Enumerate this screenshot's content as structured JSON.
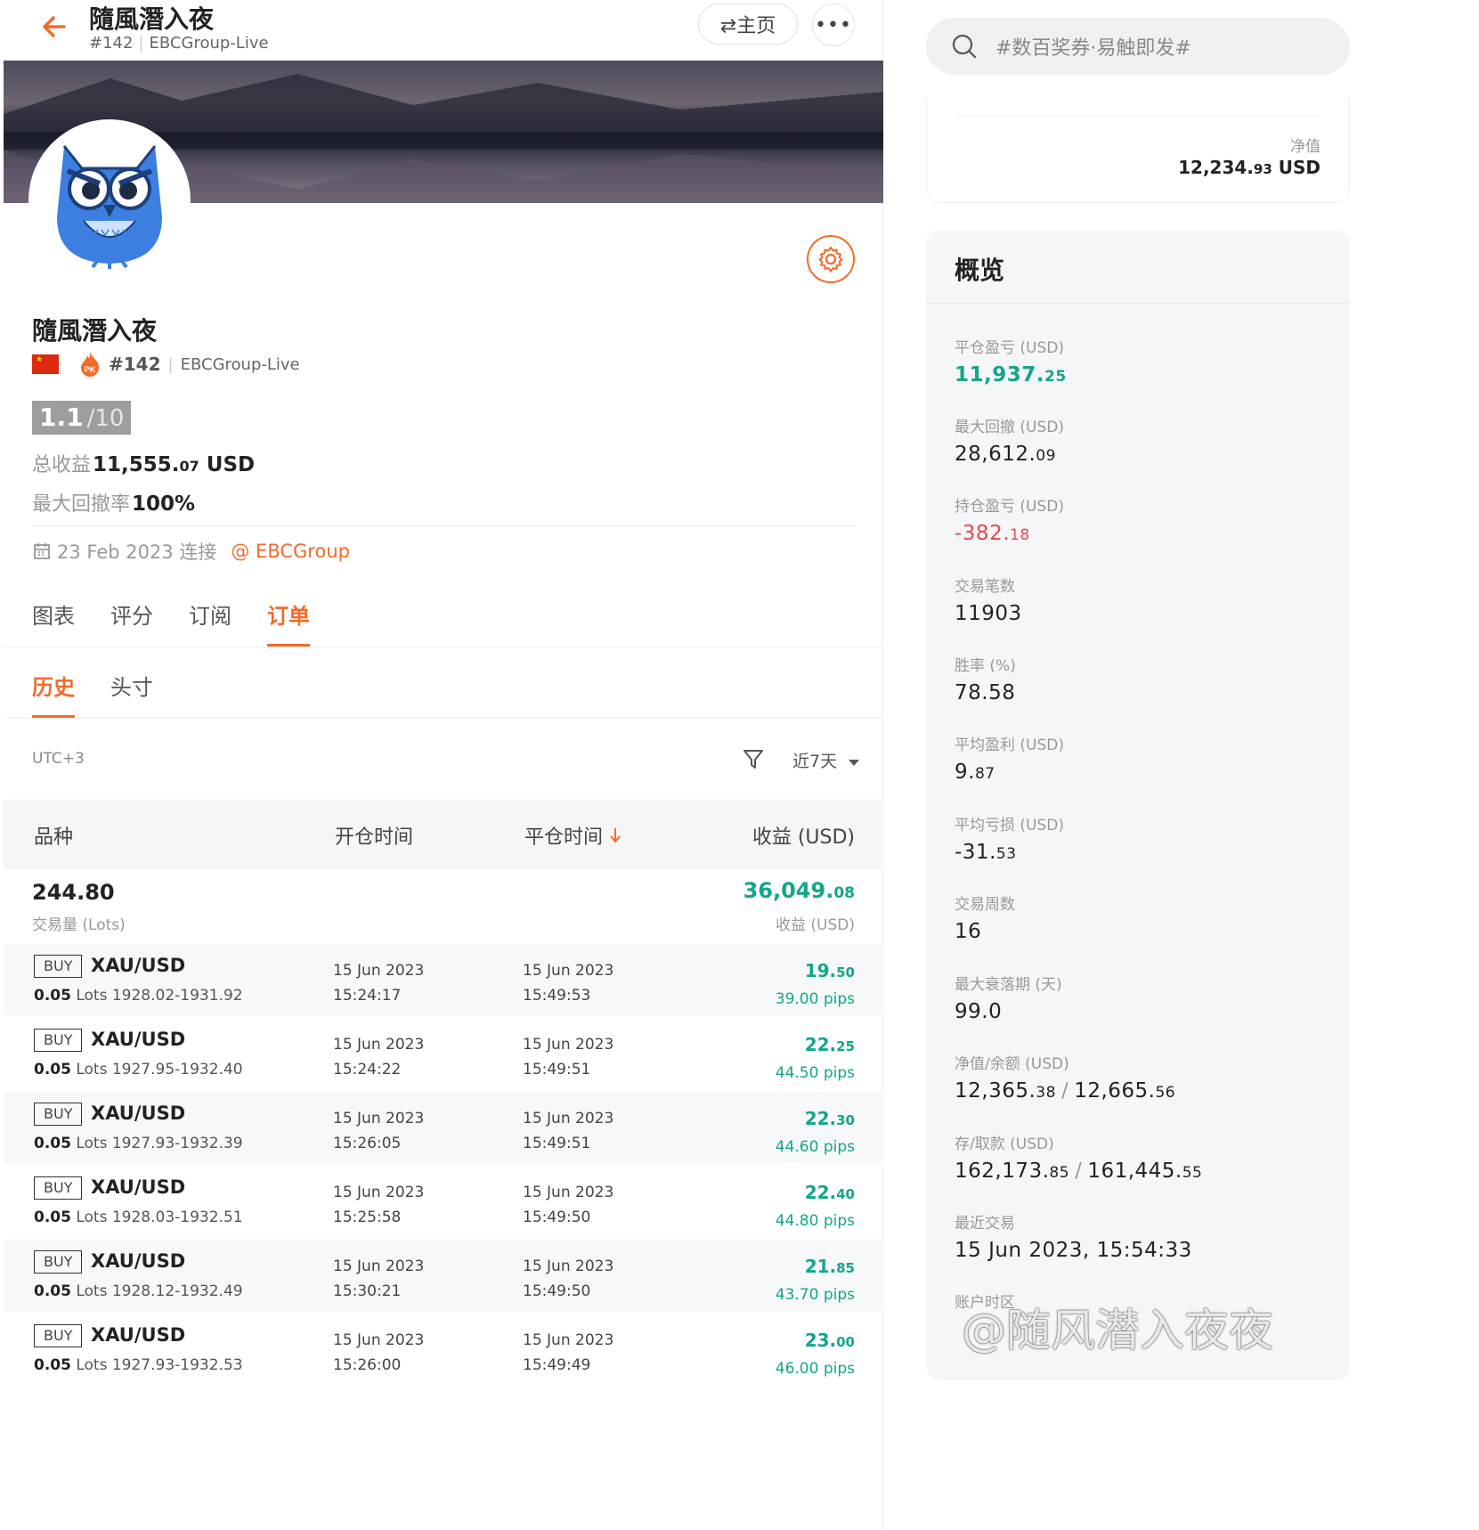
{
  "header": {
    "title": "隨風潛入夜",
    "rank": "#142",
    "broker": "EBCGroup-Live",
    "home_label": "⇄主页",
    "more_label": "•••"
  },
  "profile": {
    "name": "隨風潛入夜",
    "rank": "#142",
    "broker": "EBCGroup-Live",
    "score": "1.1",
    "score_max": "/10",
    "total_profit_label": "总收益",
    "total_profit_int": "11,555.",
    "total_profit_dec": "07",
    "total_profit_unit": " USD",
    "max_dd_label": "最大回撤率",
    "max_dd_value": "100%",
    "connected": "23 Feb 2023 连接",
    "broker_link": "@ EBCGroup"
  },
  "tabs": [
    "图表",
    "评分",
    "订阅",
    "订单"
  ],
  "subtabs": [
    "历史",
    "头寸"
  ],
  "filter": {
    "timezone": "UTC+3",
    "range": "近7天"
  },
  "table": {
    "headers": [
      "品种",
      "开仓时间",
      "平仓时间",
      "收益 (USD)"
    ],
    "summary": {
      "lots": "244.80",
      "lots_label": "交易量 (Lots)",
      "profit_int": "36,049.",
      "profit_dec": "08",
      "profit_label": "收益 (USD)"
    },
    "orders": [
      {
        "side": "BUY",
        "symbol": "XAU/USD",
        "lots": "0.05",
        "lots_unit": " Lots ",
        "range": "1928.02-1931.92",
        "open_date": "15 Jun 2023",
        "open_time": "15:24:17",
        "close_date": "15 Jun 2023",
        "close_time": "15:49:53",
        "profit_int": "19.",
        "profit_dec": "50",
        "pips": "39.00 pips"
      },
      {
        "side": "BUY",
        "symbol": "XAU/USD",
        "lots": "0.05",
        "lots_unit": " Lots ",
        "range": "1927.95-1932.40",
        "open_date": "15 Jun 2023",
        "open_time": "15:24:22",
        "close_date": "15 Jun 2023",
        "close_time": "15:49:51",
        "profit_int": "22.",
        "profit_dec": "25",
        "pips": "44.50 pips"
      },
      {
        "side": "BUY",
        "symbol": "XAU/USD",
        "lots": "0.05",
        "lots_unit": " Lots ",
        "range": "1927.93-1932.39",
        "open_date": "15 Jun 2023",
        "open_time": "15:26:05",
        "close_date": "15 Jun 2023",
        "close_time": "15:49:51",
        "profit_int": "22.",
        "profit_dec": "30",
        "pips": "44.60 pips"
      },
      {
        "side": "BUY",
        "symbol": "XAU/USD",
        "lots": "0.05",
        "lots_unit": " Lots ",
        "range": "1928.03-1932.51",
        "open_date": "15 Jun 2023",
        "open_time": "15:25:58",
        "close_date": "15 Jun 2023",
        "close_time": "15:49:50",
        "profit_int": "22.",
        "profit_dec": "40",
        "pips": "44.80 pips"
      },
      {
        "side": "BUY",
        "symbol": "XAU/USD",
        "lots": "0.05",
        "lots_unit": " Lots ",
        "range": "1928.12-1932.49",
        "open_date": "15 Jun 2023",
        "open_time": "15:30:21",
        "close_date": "15 Jun 2023",
        "close_time": "15:49:50",
        "profit_int": "21.",
        "profit_dec": "85",
        "pips": "43.70 pips"
      },
      {
        "side": "BUY",
        "symbol": "XAU/USD",
        "lots": "0.05",
        "lots_unit": " Lots ",
        "range": "1927.93-1932.53",
        "open_date": "15 Jun 2023",
        "open_time": "15:26:00",
        "close_date": "15 Jun 2023",
        "close_time": "15:49:49",
        "profit_int": "23.",
        "profit_dec": "00",
        "pips": "46.00 pips"
      }
    ]
  },
  "search": {
    "placeholder": "#数百奖券·易触即发#"
  },
  "net_value": {
    "label": "净值",
    "int": "12,234.",
    "dec": "93",
    "unit": " USD"
  },
  "overview": {
    "title": "概览",
    "closed_pl_label": "平仓盈亏 (USD)",
    "closed_pl_int": "11,937.",
    "closed_pl_dec": "25",
    "max_dd_label": "最大回撤 (USD)",
    "max_dd_int": "28,612.",
    "max_dd_dec": "09",
    "open_pl_label": "持仓盈亏 (USD)",
    "open_pl_int": "-382.",
    "open_pl_dec": "18",
    "trades_label": "交易笔数",
    "trades": "11903",
    "win_rate_label": "胜率 (%)",
    "win_rate": "78.58",
    "avg_profit_label": "平均盈利 (USD)",
    "avg_profit_int": "9.",
    "avg_profit_dec": "87",
    "avg_loss_label": "平均亏损 (USD)",
    "avg_loss_int": "-31.",
    "avg_loss_dec": "53",
    "weeks_label": "交易周数",
    "weeks": "16",
    "max_slump_label": "最大衰落期 (天)",
    "max_slump": "99.0",
    "equity_label": "净值/余额 (USD)",
    "equity_int": "12,365.",
    "equity_dec": "38",
    "balance_int": "12,665.",
    "balance_dec": "56",
    "deposit_label": "存/取款 (USD)",
    "deposit_int": "162,173.",
    "deposit_dec": "85",
    "withdraw_int": "161,445.",
    "withdraw_dec": "55",
    "last_trade_label": "最近交易",
    "last_trade": "15 Jun 2023, 15:54:33",
    "timezone_label": "账户时区"
  },
  "watermark": "@随风潜入夜夜",
  "colors": {
    "accent": "#f26b2a",
    "profit": "#13a68a",
    "loss": "#e5484d"
  }
}
